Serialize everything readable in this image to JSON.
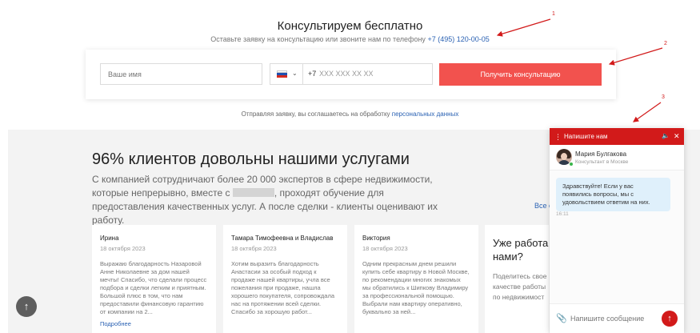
{
  "consult": {
    "title": "Консультируем бесплатно",
    "subtitle": "Оставьте заявку на консультацию или звоните нам по телефону",
    "phone": "+7 (495) 120-00-05"
  },
  "form": {
    "name_placeholder": "Ваше имя",
    "phone_code": "+7",
    "phone_mask": "XXX XXX XX XX",
    "submit_label": "Получить консультацию"
  },
  "agreement": {
    "text": "Отправляя заявку, вы соглашаетесь на обработку",
    "link": "персональных данных"
  },
  "reviews_section": {
    "heading": "96% клиентов довольны нашими услугами",
    "lead_1": "С компанией сотрудничают более 20 000 экспертов в сфере недвижимости, которые непрерывно, вместе с",
    "lead_2": ", проходят обучение для предоставления качественных услуг. А после сделки - клиенты оценивают их работу.",
    "all_link": "Все о",
    "items": [
      {
        "author": "Ирина",
        "date": "18 октября 2023",
        "text": "Выражаю благодарность Назаровой Анне Николаевне за дом нашей мечты! Спасибо, что сделали процесс подбора и сделки легким и приятным. Большой плюс в том, что нам предоставили финансовую гарантию от компании на 2...",
        "more": "Подробнее"
      },
      {
        "author": "Тамара Тимофеевна и Владислав",
        "date": "18 октября 2023",
        "text": "Хотим выразить благодарность Анастасии за особый подход к продаже нашей квартиры, учла все пожелания при продаже, нашла хорошего покупателя, сопровождала нас на протяжении всей сделки. Спасибо за хорошую работ..."
      },
      {
        "author": "Виктория",
        "date": "18 октября 2023",
        "text": "Одним прекрасным днем решили купить себе квартиру в Новой Москве, по рекомендации многих знакомых мы обратились к Шипкову Владимиру за профессиональной помощью. Выбрали нам квартиру оперативно, буквально за ней..."
      }
    ],
    "side_card": {
      "question_1": "Уже работа",
      "question_2": "нами?",
      "desc_1": "Поделитесь свое",
      "desc_2": "качестве работы",
      "desc_3": "по недвижимост"
    }
  },
  "chat": {
    "header_title": "Напишите нам",
    "operator_name": "Мария Булгакова",
    "operator_role": "Консультант в Москве",
    "message": "Здравствуйте! Если у вас появились вопросы, мы с удовольствием ответим на них.",
    "time": "16:11",
    "input_placeholder": "Напишите сообщение"
  },
  "annotations": [
    "1",
    "2",
    "3"
  ],
  "colors": {
    "accent_red": "#f2524e",
    "chat_red": "#d21a1a",
    "link_blue": "#2b62b3"
  }
}
